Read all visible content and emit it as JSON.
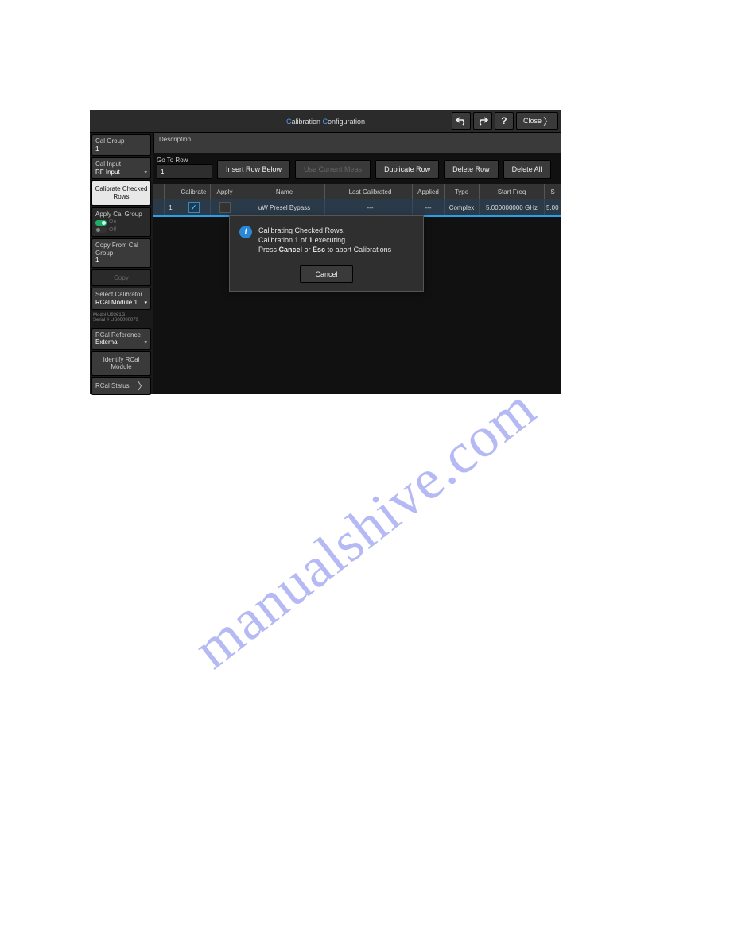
{
  "watermark": "manualshive.com",
  "titlebar": {
    "title_pre": "C",
    "title_mid": "alibration ",
    "title_pre2": "C",
    "title_rest": "onfiguration",
    "close": "Close"
  },
  "sidebar": {
    "cal_group": {
      "label": "Cal Group",
      "value": "1"
    },
    "cal_input": {
      "label": "Cal Input",
      "value": "RF Input"
    },
    "calibrate_checked": "Calibrate Checked Rows",
    "apply_cal_group": {
      "label": "Apply Cal Group",
      "on": "On",
      "off": "Off"
    },
    "copy_from": {
      "label": "Copy From Cal Group",
      "value": "1"
    },
    "copy_btn": "Copy",
    "select_calibrator": {
      "label": "Select Calibrator",
      "value": "RCal Module 1"
    },
    "serial": {
      "line1": "Model U9361G",
      "line2": "Serial # US00000079"
    },
    "rcal_ref": {
      "label": "RCal Reference",
      "value": "External"
    },
    "identify": "Identify RCal Module",
    "rcal_status": "RCal Status"
  },
  "main": {
    "description_label": "Description",
    "goto_label": "Go To Row",
    "goto_value": "1",
    "buttons": {
      "insert": "Insert Row Below",
      "use_current": "Use Current Meas",
      "duplicate": "Duplicate Row",
      "delete": "Delete Row",
      "delete_all": "Delete All"
    }
  },
  "table": {
    "headers": {
      "calibrate": "Calibrate",
      "apply": "Apply",
      "name": "Name",
      "last": "Last Calibrated",
      "applied": "Applied",
      "type": "Type",
      "start": "Start Freq",
      "extra": "S"
    },
    "row": {
      "num": "1",
      "name": "uW Presel Bypass",
      "last": "---",
      "applied": "---",
      "type": "Complex",
      "start": "5.000000000 GHz",
      "extra": "5.00"
    }
  },
  "modal": {
    "line1": "Calibrating Checked Rows.",
    "line2a": "Calibration ",
    "line2b": "1",
    "line2c": " of ",
    "line2d": "1",
    "line2e": " executing ............",
    "line3a": "Press ",
    "line3b": "Cancel",
    "line3c": " or ",
    "line3d": "Esc",
    "line3e": " to abort Calibrations",
    "cancel": "Cancel"
  }
}
